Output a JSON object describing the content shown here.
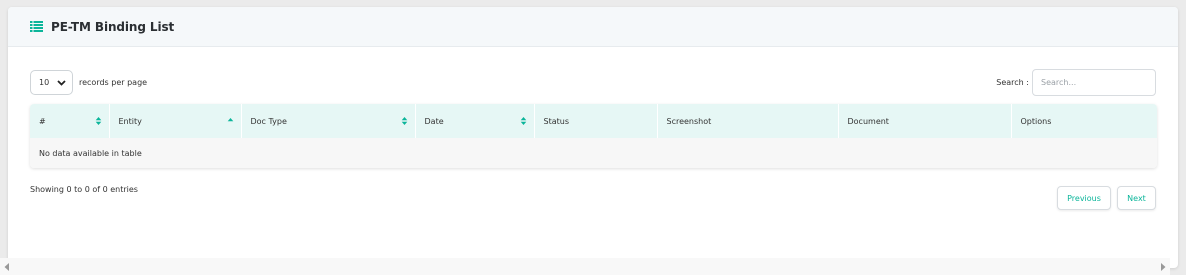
{
  "header": {
    "title": "PE-TM Binding List",
    "icon": "list-icon",
    "accent": "#0bb59a"
  },
  "length_control": {
    "selected": "10",
    "label": "records per page"
  },
  "search": {
    "label": "Search :",
    "placeholder": "Search...",
    "value": ""
  },
  "table": {
    "columns": [
      {
        "label": "#",
        "sort": "both"
      },
      {
        "label": "Entity",
        "sort": "asc"
      },
      {
        "label": "Doc Type",
        "sort": "both"
      },
      {
        "label": "Date",
        "sort": "both"
      },
      {
        "label": "Status",
        "sort": "none"
      },
      {
        "label": "Screenshot",
        "sort": "none"
      },
      {
        "label": "Document",
        "sort": "none"
      },
      {
        "label": "Options",
        "sort": "none"
      }
    ],
    "empty_message": "No data available in table",
    "header_bg": "#e6f7f5"
  },
  "footer": {
    "info": "Showing 0 to 0 of 0 entries",
    "previous_label": "Previous",
    "next_label": "Next"
  }
}
